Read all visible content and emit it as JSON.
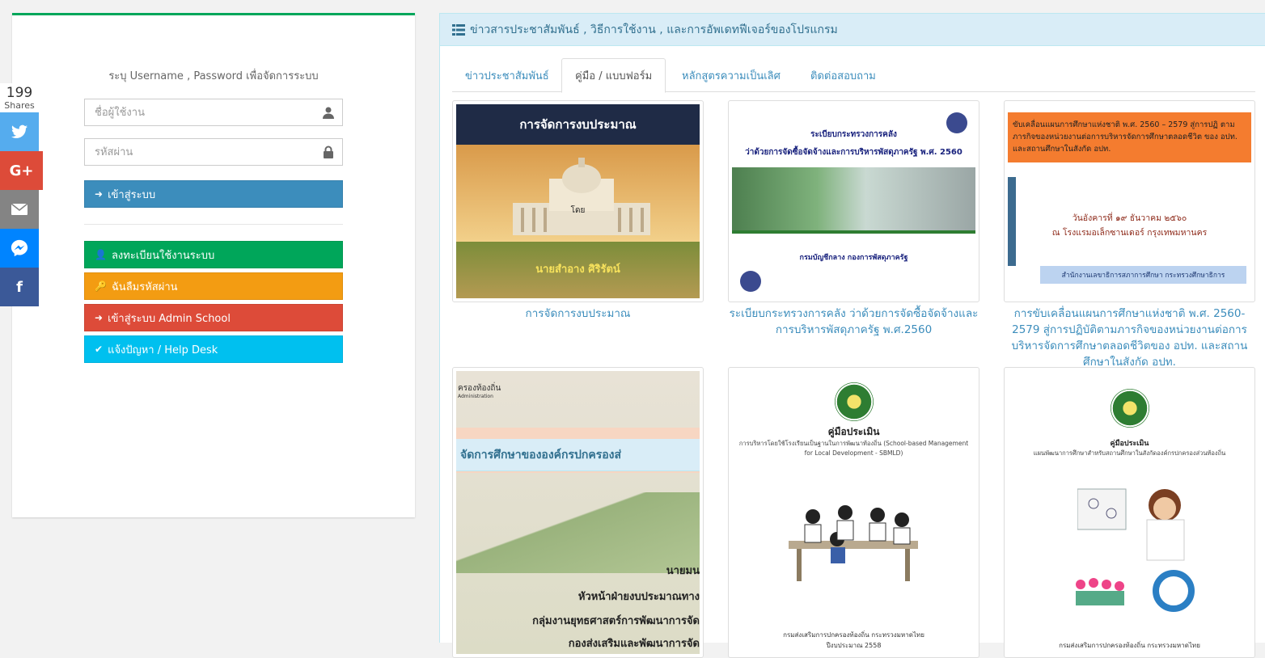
{
  "share": {
    "count": "199",
    "count_label": "Shares",
    "buttons": [
      {
        "name": "twitter",
        "icon": "twitter-icon",
        "color": "#55acee"
      },
      {
        "name": "google-plus",
        "icon": "google-plus-icon",
        "label": "G+",
        "color": "#dd4b39"
      },
      {
        "name": "email",
        "icon": "email-icon",
        "color": "#848484"
      },
      {
        "name": "messenger",
        "icon": "messenger-icon",
        "color": "#0084ff"
      },
      {
        "name": "facebook",
        "icon": "facebook-icon",
        "label": "f",
        "color": "#3b5998"
      }
    ]
  },
  "login": {
    "hint": "ระบุ Username , Password เพื่อจัดการระบบ",
    "username_placeholder": "ชื่อผู้ใช้งาน",
    "password_placeholder": "รหัสผ่าน",
    "login_button": "เข้าสู่ระบบ",
    "register_button": "ลงทะเบียนใช้งานระบบ",
    "forgot_button": "ฉันลืมรหัสผ่าน",
    "admin_button": "เข้าสู่ระบบ Admin School",
    "help_button": "แจ้งปัญหา / Help Desk",
    "colors": {
      "login": "#3c8dbc",
      "register": "#00a65a",
      "forgot": "#f39c12",
      "admin": "#dd4b39",
      "help": "#00c0ef"
    }
  },
  "news": {
    "title": "ข่าวสารประชาสัมพันธ์ , วิธีการใช้งาน , และการอัพเดทฟีเจอร์ของโปรแกรม",
    "tabs": [
      {
        "label": "ข่าวประชาสัมพันธ์",
        "active": false
      },
      {
        "label": "คู่มือ / แบบฟอร์ม",
        "active": true
      },
      {
        "label": "หลักสูตรความเป็นเลิศ",
        "active": false
      },
      {
        "label": "ติดต่อสอบถาม",
        "active": false
      }
    ],
    "cards": [
      {
        "caption": "การจัดการงบประมาณ",
        "thumb_title": "การจัดการงบประมาณ",
        "thumb_author": "นายสำอาง ศิริรัตน์",
        "thumb_label": "โดย"
      },
      {
        "caption": "ระเบียบกระทรวงการคลัง ว่าด้วยการจัดซื้อจัดจ้างและการบริหารพัสดุภาครัฐ พ.ศ.2560",
        "thumb_line1": "ระเบียบกระทรวงการคลัง",
        "thumb_line2": "ว่าด้วยการจัดซื้อจัดจ้างและการบริหารพัสดุภาครัฐ พ.ศ. 2560",
        "thumb_dept": "กรมบัญชีกลาง กองการพัสดุภาครัฐ"
      },
      {
        "caption": "การขับเคลื่อนแผนการศึกษาแห่งชาติ พ.ศ. 2560-2579 สู่การปฏิบัติตามภารกิจของหน่วยงานต่อการบริหารจัดการศึกษาตลอดชีวิตของ อปท. และสถานศึกษาในสังกัด อปท.",
        "thumb_orange": "ขับเคลื่อนแผนการศึกษาแห่งชาติ พ.ศ. 2560 – 2579 สู่การปฏิ ตามภารกิจของหน่วยงานต่อการบริหารจัดการศึกษาตลอดชีวิต ของ อปท. และสถานศึกษาในสังกัด อปท.",
        "thumb_date": "วันอังคารที่ ๑๙ ธันวาคม ๒๕๖๐",
        "thumb_place": "ณ โรงแรมอเล็กซานเดอร์ กรุงเทพมหานคร",
        "thumb_bottom": "สำนักงานเลขาธิการสภาการศึกษา กระทรวงศึกษาธิการ"
      },
      {
        "thumb_top": "ครองท้องถิ่น",
        "thumb_top2": "Administration",
        "thumb_head": "จัดการศึกษาขององค์กรปกครองส่",
        "thumb_name": "นายมน",
        "thumb_l1": "หัวหน้าฝ่ายงบประมาณทาง",
        "thumb_l2": "กลุ่มงานยุทธศาสตร์การพัฒนาการจัด",
        "thumb_l3": "กองส่งเสริมและพัฒนาการจัด"
      },
      {
        "thumb_title": "คู่มือประเมิน",
        "thumb_sub": "การบริหารโดยใช้โรงเรียนเป็นฐานในการพัฒนาท้องถิ่น (School-based Management for Local Development - SBMLD)",
        "thumb_foot": "กรมส่งเสริมการปกครองท้องถิ่น กระทรวงมหาดไทย",
        "thumb_year": "ปีงบประมาณ 2558"
      },
      {
        "thumb_title": "คู่มือประเมิน",
        "thumb_sub": "แผนพัฒนาการศึกษาสำหรับสถานศึกษาในสังกัดองค์กรปกครองส่วนท้องถิ่น",
        "thumb_foot": "กรมส่งเสริมการปกครองท้องถิ่น กระทรวงมหาดไทย"
      }
    ]
  }
}
